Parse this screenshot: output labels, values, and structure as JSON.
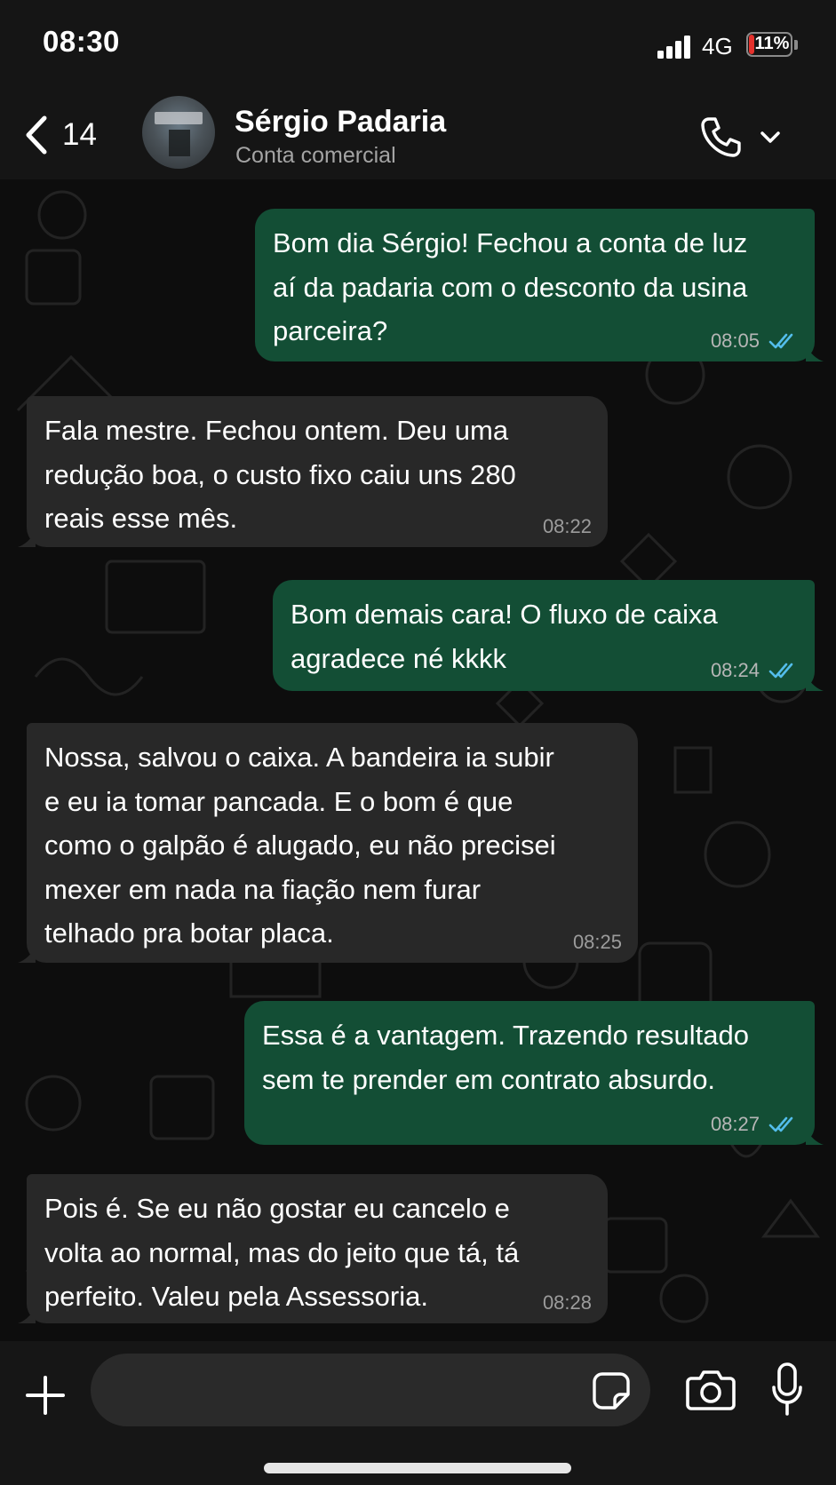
{
  "status_bar": {
    "time": "08:30",
    "network": "4G",
    "battery": "11%",
    "battery_color": "#e5312c"
  },
  "header": {
    "back_count": "14",
    "contact_name": "Sérgio Padaria",
    "contact_subtitle": "Conta comercial",
    "icons": [
      "chevron-left-icon",
      "phone-icon",
      "chevron-down-icon"
    ]
  },
  "colors": {
    "sent_bubble": "#134e35",
    "received_bubble": "#282828",
    "read_ticks": "#53bdeb"
  },
  "messages": [
    {
      "direction": "sent",
      "text": "Bom dia Sérgio! Fechou a conta de luz\naí da padaria com o desconto da usina\nparceira?",
      "time": "08:05",
      "status": "read"
    },
    {
      "direction": "received",
      "text": "Fala mestre. Fechou ontem. Deu uma\nredução boa, o custo fixo caiu uns 280\nreais esse mês.",
      "time": "08:22"
    },
    {
      "direction": "sent",
      "text": "Bom demais cara! O fluxo de caixa\nagradece né kkkk",
      "time": "08:24",
      "status": "read"
    },
    {
      "direction": "received",
      "text": "Nossa,  salvou o caixa. A bandeira ia subir\ne eu ia tomar pancada. E o bom é que\ncomo o galpão é alugado, eu não precisei\nmexer em nada na fiação nem furar\ntelhado pra botar placa.",
      "time": "08:25"
    },
    {
      "direction": "sent",
      "text": "Essa é a vantagem. Trazendo resultado\nsem te prender em contrato absurdo.",
      "time": "08:27",
      "status": "read"
    },
    {
      "direction": "received",
      "text": "Pois é. Se eu não gostar eu cancelo e\nvolta ao normal, mas do jeito que tá, tá\nperfeito. Valeu pela Assessoria.",
      "time": "08:28"
    }
  ],
  "composer": {
    "input_value": "",
    "icons": [
      "plus-icon",
      "sticker-icon",
      "camera-icon",
      "mic-icon"
    ]
  }
}
